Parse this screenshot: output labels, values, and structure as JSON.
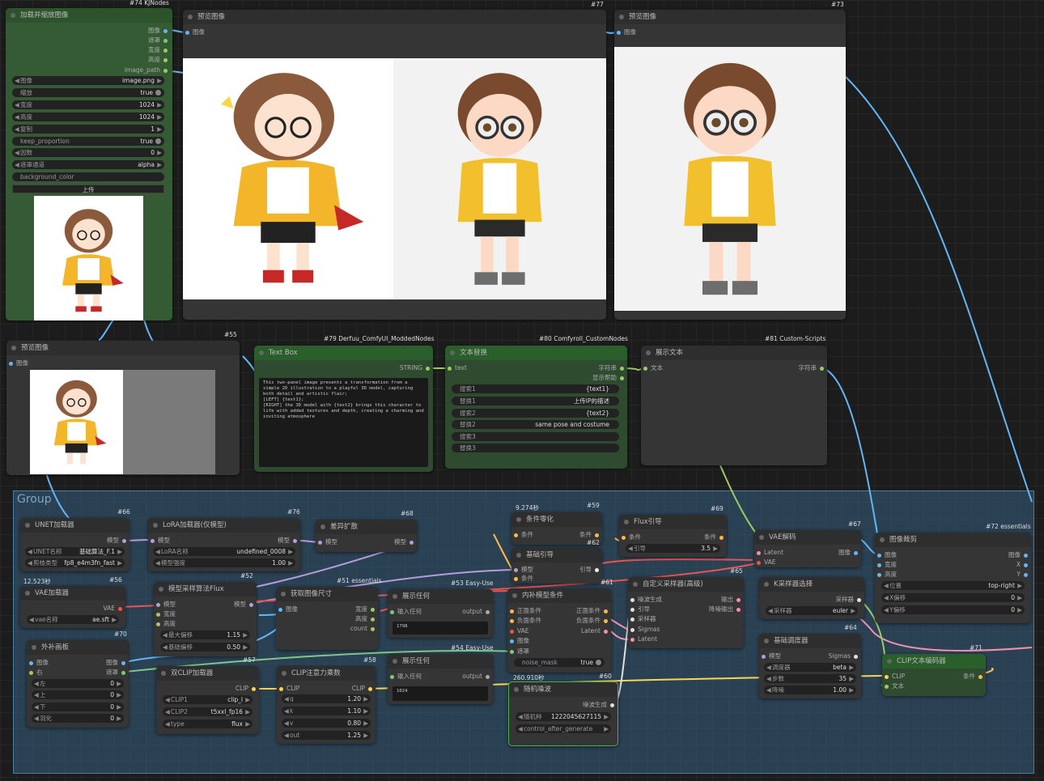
{
  "group": {
    "title": "Group"
  },
  "badges": {
    "b74": "#74 KJNodes",
    "b77": "#77",
    "b73": "#73",
    "b55": "#55",
    "b79": "#79 Derfuu_ComfyUI_ModdedNodes",
    "b80": "#80 Comfyroll_CustomNodes",
    "b81": "#81 Custom-Scripts",
    "b66": "#66",
    "b76": "#76",
    "b68": "#68",
    "b59": "#59",
    "b69": "#69",
    "b67": "#67",
    "b72": "#72 essentials",
    "b56": "#56",
    "b52": "#52",
    "b51": "#51 essentials",
    "b53": "#53 Easy-Use",
    "b62": "#62",
    "b61": "#61",
    "b65": "#65",
    "b70": "#70",
    "b57": "#57",
    "b58": "#58",
    "b54": "#54 Easy-Use",
    "b60": "#60",
    "b64": "#64",
    "b71": "#71"
  },
  "load_image": {
    "title": "加载并缩放图像",
    "outputs": [
      "图像",
      "遮罩",
      "宽度",
      "高度",
      "image_path"
    ],
    "widgets": [
      {
        "label": "图像",
        "value": "image.png"
      },
      {
        "label": "缩放",
        "value": "true"
      },
      {
        "label": "宽度",
        "value": "1024"
      },
      {
        "label": "高度",
        "value": "1024"
      },
      {
        "label": "复制",
        "value": "1"
      },
      {
        "label": "keep_proportion",
        "value": "true"
      },
      {
        "label": "因数",
        "value": "0"
      },
      {
        "label": "遮罩通道",
        "value": "alpha"
      },
      {
        "label": "background_color",
        "value": ""
      }
    ],
    "upload": "上传"
  },
  "preview77": {
    "title": "预览图像",
    "input": "图像"
  },
  "preview73": {
    "title": "预览图像",
    "input": "图像"
  },
  "preview55": {
    "title": "预览图像",
    "input": "图像"
  },
  "textbox": {
    "title": "Text Box",
    "output": "STRING",
    "text": "This two-panel image presents a transformation from a simple 2D illustration to a playful 3D model, capturing both detail and artistic flair;\n[LEFT] {text1};\n[RIGHT] the 3D model with {text2} brings this character to life with added textures and depth, creating a charming and inviting atmosphere"
  },
  "replace": {
    "title": "文本替换",
    "input": "text",
    "outputs": [
      "字符串",
      "显示帮助"
    ],
    "widgets": [
      {
        "label": "搜索1",
        "value": "{text1}"
      },
      {
        "label": "替换1",
        "value": "上传IP的描述"
      },
      {
        "label": "搜索2",
        "value": "{text2}"
      },
      {
        "label": "替换2",
        "value": "same pose and costume"
      },
      {
        "label": "搜索3",
        "value": ""
      },
      {
        "label": "替换3",
        "value": ""
      }
    ]
  },
  "showtext": {
    "title": "展示文本",
    "input": "文本",
    "output": "字符串"
  },
  "unet": {
    "title": "UNET加载器",
    "output": "模型",
    "widgets": [
      {
        "label": "UNET名称",
        "value": "基础算法_F.1"
      },
      {
        "label": "剪枝类型",
        "value": "fp8_e4m3fn_fast"
      }
    ]
  },
  "lora": {
    "title": "LoRA加载器(仅模型)",
    "input": "模型",
    "output": "模型",
    "widgets": [
      {
        "label": "LoRA名称",
        "value": "undefined_0008"
      },
      {
        "label": "模型强度",
        "value": "1.00"
      }
    ]
  },
  "diff": {
    "title": "差异扩散",
    "input": "模型",
    "output": "模型"
  },
  "condzero": {
    "title": "条件零化",
    "timer": "9.274秒",
    "input": "条件",
    "output": "条件"
  },
  "flux": {
    "title": "Flux引导",
    "input": "条件",
    "output": "条件",
    "widgets": [
      {
        "label": "引导",
        "value": "3.5"
      }
    ]
  },
  "vaedecode": {
    "title": "VAE解码",
    "inputs": [
      "Latent",
      "VAE"
    ],
    "output": "图像"
  },
  "crop": {
    "title": "图像裁剪",
    "inputs": [
      "图像",
      "宽度",
      "高度"
    ],
    "outputs": [
      "图像",
      "X",
      "Y"
    ],
    "widgets": [
      {
        "label": "位置",
        "value": "top-right"
      },
      {
        "label": "X偏移",
        "value": "0"
      },
      {
        "label": "Y偏移",
        "value": "0"
      }
    ]
  },
  "vaeload": {
    "title": "VAE加载器",
    "timer": "12.523秒",
    "output": "VAE",
    "widgets": [
      {
        "label": "vae名称",
        "value": "ae.sft"
      }
    ]
  },
  "sampling": {
    "title": "模型采样算法Flux",
    "inputs": [
      "模型",
      "宽度",
      "高度"
    ],
    "output": "模型",
    "widgets": [
      {
        "label": "最大偏移",
        "value": "1.15"
      },
      {
        "label": "基础偏移",
        "value": "0.50"
      }
    ]
  },
  "getsize": {
    "title": "获取图像尺寸",
    "input": "图像",
    "outputs": [
      "宽度",
      "高度",
      "count"
    ]
  },
  "show1": {
    "title": "展示任何",
    "input": "输入任何",
    "output": "output",
    "text": "1798"
  },
  "guide": {
    "title": "基础引导",
    "inputs": [
      "模型",
      "条件"
    ],
    "output": "引导"
  },
  "inpaint": {
    "title": "内补模型条件",
    "inputs": [
      "正面条件",
      "负面条件",
      "VAE",
      "图像",
      "遮罩"
    ],
    "outputs": [
      "正面条件",
      "负面条件",
      "Latent"
    ],
    "widgets": [
      {
        "label": "noise_mask",
        "value": "true"
      }
    ]
  },
  "custsamp": {
    "title": "自定义采样器(高级)",
    "inputs": [
      "噪波生成",
      "引导",
      "采样器",
      "Sigmas",
      "Latent"
    ],
    "outputs": [
      "输出",
      "降噪输出"
    ]
  },
  "ksel": {
    "title": "K采样器选择",
    "output": "采样器",
    "widgets": [
      {
        "label": "采样器",
        "value": "euler"
      }
    ]
  },
  "basesched": {
    "title": "基础调度器",
    "input": "模型",
    "output": "Sigmas",
    "widgets": [
      {
        "label": "调度器",
        "value": "beta"
      },
      {
        "label": "步数",
        "value": "35"
      },
      {
        "label": "降噪",
        "value": "1.00"
      }
    ]
  },
  "outpaint": {
    "title": "外补画板",
    "inputs": [
      "图像",
      "右"
    ],
    "outputs": [
      "图像",
      "遮罩"
    ],
    "widgets": [
      {
        "label": "左",
        "value": "0"
      },
      {
        "label": "上",
        "value": "0"
      },
      {
        "label": "下",
        "value": "0"
      },
      {
        "label": "羽化",
        "value": "0"
      }
    ]
  },
  "dualclip": {
    "title": "双CLIP加载器",
    "output": "CLIP",
    "widgets": [
      {
        "label": "CLIP1",
        "value": "clip_l"
      },
      {
        "label": "CLIP2",
        "value": "t5xxl_fp16"
      },
      {
        "label": "type",
        "value": "flux"
      }
    ]
  },
  "clipatt": {
    "title": "CLIP注意力乘数",
    "input": "CLIP",
    "output": "CLIP",
    "widgets": [
      {
        "label": "q",
        "value": "1.20"
      },
      {
        "label": "k",
        "value": "1.10"
      },
      {
        "label": "v",
        "value": "0.80"
      },
      {
        "label": "out",
        "value": "1.25"
      }
    ]
  },
  "show2": {
    "title": "展示任何",
    "input": "输入任何",
    "output": "output",
    "text": "1024"
  },
  "noise": {
    "title": "随机噪波",
    "timer": "260.910秒",
    "output": "噪波生成",
    "widgets": [
      {
        "label": "随机种",
        "value": "1222045627115"
      },
      {
        "label": "control_after_generate",
        "value": ""
      }
    ]
  },
  "clipenc": {
    "title": "CLIP文本编码器",
    "inputs": [
      "CLIP",
      "文本"
    ],
    "output": "条件"
  }
}
